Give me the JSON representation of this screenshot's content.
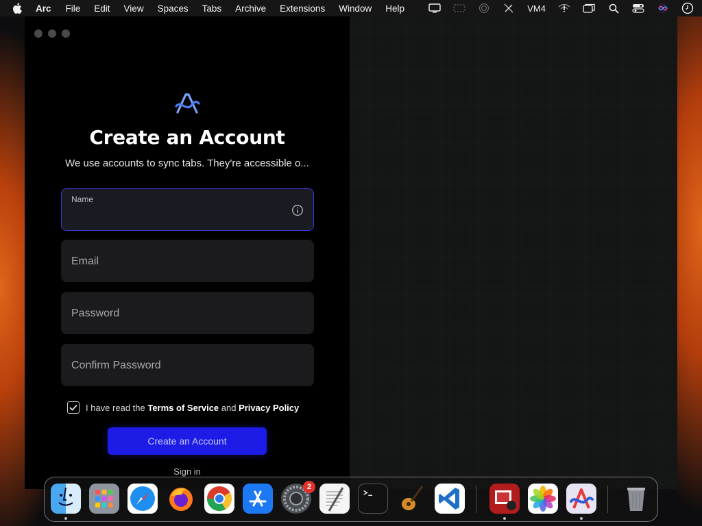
{
  "menubar": {
    "app_name": "Arc",
    "items": [
      "File",
      "Edit",
      "View",
      "Spaces",
      "Tabs",
      "Archive",
      "Extensions",
      "Window",
      "Help"
    ],
    "status_text": "VM4"
  },
  "form": {
    "title": "Create an Account",
    "subtitle": "We use accounts to sync tabs. They're accessible o...",
    "name_label": "Name",
    "email_placeholder": "Email",
    "password_placeholder": "Password",
    "confirm_placeholder": "Confirm Password",
    "terms_prefix": "I have read the ",
    "terms_link": "Terms of Service",
    "terms_and": " and ",
    "privacy_link": "Privacy Policy",
    "terms_checked": true,
    "create_button": "Create an Account",
    "sign_in": "Sign in"
  },
  "dock": {
    "items": [
      "Finder",
      "Launchpad",
      "Safari",
      "Firefox",
      "Chrome",
      "App Store",
      "System Settings",
      "TextEdit",
      "Terminal",
      "GarageBand",
      "VS Code",
      "Photo Booth",
      "Photos",
      "Arc",
      "Trash"
    ],
    "settings_badge": "2"
  },
  "colors": {
    "accent": "#1c1ce6",
    "focus_border": "#3a3ad8",
    "wallpaper_orange": "#e0661a"
  }
}
